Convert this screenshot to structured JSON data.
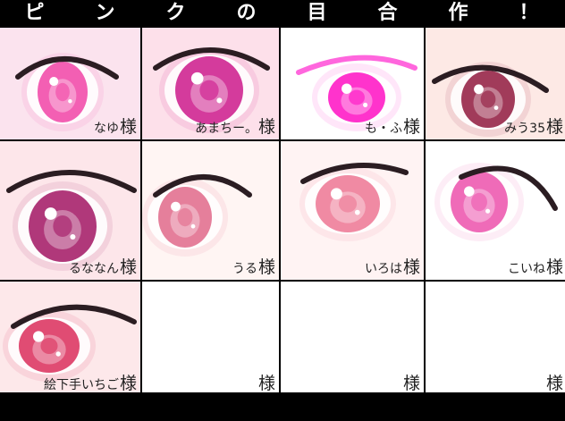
{
  "title_chars": [
    "ピ",
    "ン",
    "ク",
    "の",
    "目",
    "合",
    "作",
    "！"
  ],
  "cells": [
    {
      "artist": "なゆ",
      "suffix": "様",
      "artist_color": "#2a2a2a",
      "iris": "#f35fb3",
      "bg": "#fbe3ee"
    },
    {
      "artist": "あまちー。",
      "suffix": "様",
      "artist_color": "#e61e6e",
      "iris": "#d43b9c",
      "bg": "#fde0ea"
    },
    {
      "artist": "も・ふ",
      "suffix": "様",
      "artist_color": "#1fa592",
      "iris": "#ff33cc",
      "bg": "#ffffff"
    },
    {
      "artist": "みう35",
      "suffix": "様",
      "artist_color": "#1e3a36",
      "iris": "#a13b5a",
      "bg": "#fde9e5"
    },
    {
      "artist": "るななん",
      "suffix": "様",
      "artist_color": "#b9b2ee",
      "iris": "#b0387a",
      "bg": "#fde6ea"
    },
    {
      "artist": "うる",
      "suffix": "様",
      "artist_color": "#f7b6bd",
      "iris": "#e57f9b",
      "bg": "#fff5f3"
    },
    {
      "artist": "いろは",
      "suffix": "様",
      "artist_color": "#e68c8c",
      "iris": "#f08aa3",
      "bg": "#fff3f3"
    },
    {
      "artist": "こいね",
      "suffix": "様",
      "artist_color": "#f27fa8",
      "iris": "#ef6bb8",
      "bg": "#ffffff"
    },
    {
      "artist": "絵下手いちご",
      "suffix": "様",
      "artist_color": "#333333",
      "iris": "#e04c73",
      "bg": "#fde8ea"
    },
    {
      "artist": "",
      "suffix": "様",
      "artist_color": "#333333",
      "iris": "",
      "bg": "#ffffff"
    },
    {
      "artist": "",
      "suffix": "様",
      "artist_color": "#333333",
      "iris": "",
      "bg": "#ffffff"
    },
    {
      "artist": "",
      "suffix": "様",
      "artist_color": "#333333",
      "iris": "",
      "bg": "#ffffff"
    }
  ]
}
